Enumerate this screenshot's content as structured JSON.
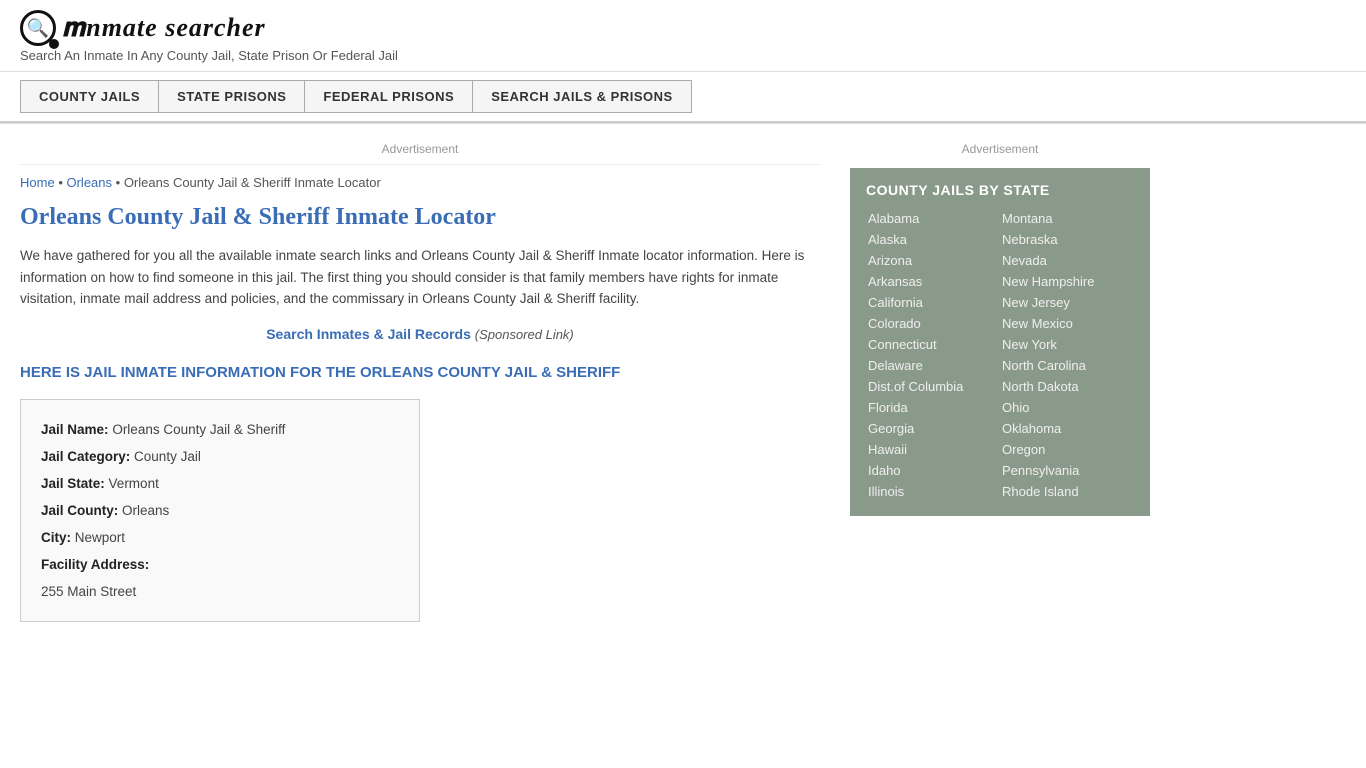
{
  "logo": {
    "icon_symbol": "🔍",
    "text_prefix": "inmate",
    "text_suffix": "searcher",
    "tagline": "Search An Inmate In Any County Jail, State Prison Or Federal Jail"
  },
  "nav": {
    "items": [
      {
        "id": "county-jails",
        "label": "COUNTY JAILS"
      },
      {
        "id": "state-prisons",
        "label": "STATE PRISONS"
      },
      {
        "id": "federal-prisons",
        "label": "FEDERAL PRISONS"
      },
      {
        "id": "search-jails",
        "label": "SEARCH JAILS & PRISONS"
      }
    ]
  },
  "ad_label": "Advertisement",
  "breadcrumb": {
    "home": "Home",
    "separator": "•",
    "location": "Orleans",
    "current": "Orleans County Jail & Sheriff Inmate Locator"
  },
  "page_title": "Orleans County Jail & Sheriff Inmate Locator",
  "intro": "We have gathered for you all the available inmate search links and Orleans County Jail & Sheriff Inmate locator information. Here is information on how to find someone in this jail. The first thing you should consider is that family members have rights for inmate visitation, inmate mail address and policies, and the commissary in Orleans County Jail & Sheriff facility.",
  "search_link": {
    "text": "Search Inmates & Jail Records",
    "sponsored": "(Sponsored Link)"
  },
  "section_heading": "HERE IS JAIL INMATE INFORMATION FOR THE ORLEANS COUNTY JAIL & SHERIFF",
  "jail_info": {
    "name_label": "Jail Name:",
    "name_value": "Orleans County Jail & Sheriff",
    "category_label": "Jail Category:",
    "category_value": "County Jail",
    "state_label": "Jail State:",
    "state_value": "Vermont",
    "county_label": "Jail County:",
    "county_value": "Orleans",
    "city_label": "City:",
    "city_value": "Newport",
    "address_label": "Facility Address:",
    "address_value": "255 Main Street"
  },
  "sidebar": {
    "ad_label": "Advertisement",
    "section_title": "COUNTY JAILS BY STATE",
    "states_col1": [
      "Alabama",
      "Alaska",
      "Arizona",
      "Arkansas",
      "California",
      "Colorado",
      "Connecticut",
      "Delaware",
      "Dist.of Columbia",
      "Florida",
      "Georgia",
      "Hawaii",
      "Idaho",
      "Illinois"
    ],
    "states_col2": [
      "Montana",
      "Nebraska",
      "Nevada",
      "New Hampshire",
      "New Jersey",
      "New Mexico",
      "New York",
      "North Carolina",
      "North Dakota",
      "Ohio",
      "Oklahoma",
      "Oregon",
      "Pennsylvania",
      "Rhode Island"
    ]
  }
}
